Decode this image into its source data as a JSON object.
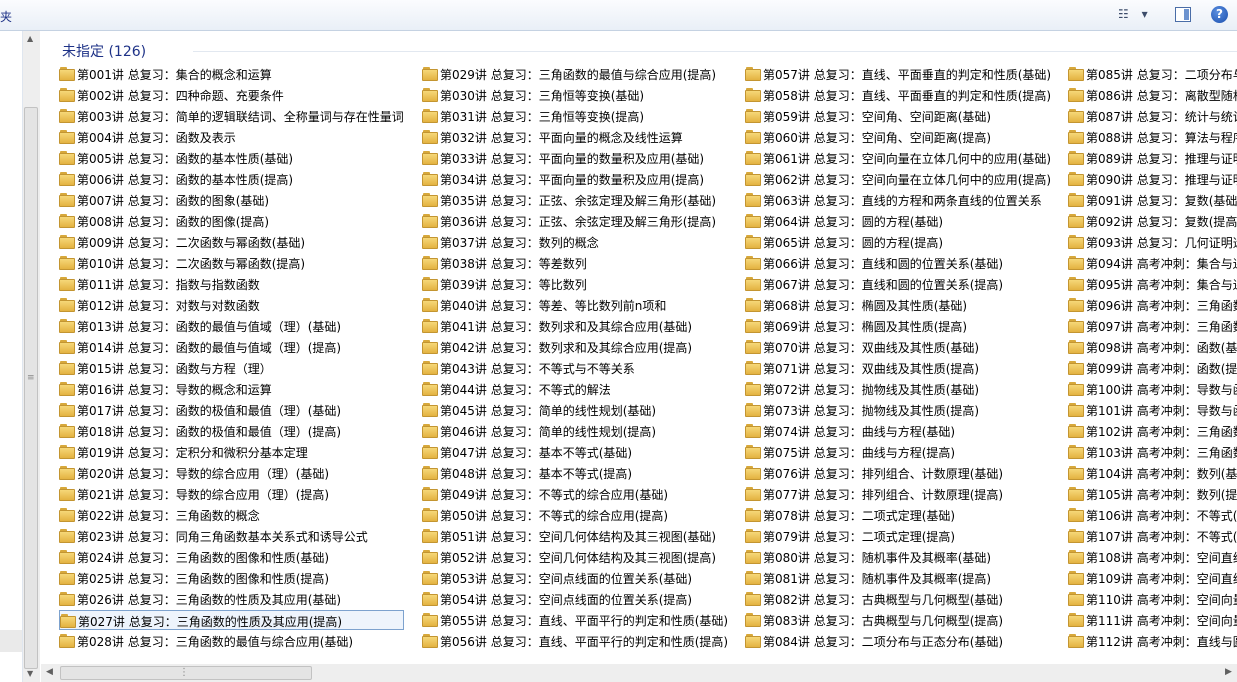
{
  "toolbar": {
    "left_text": "夹",
    "view_glyph": "☷",
    "view_dropdown": "▾",
    "help_glyph": "?"
  },
  "group": {
    "header": "未指定 (126)"
  },
  "icons": {
    "folder": "folder-icon",
    "help": "help-icon",
    "views": "change-view-icon",
    "preview": "preview-pane-icon"
  },
  "colors": {
    "header_blue": "#1e3287",
    "folder_yellow": "#e3b241",
    "selection_border": "#7da2ce"
  },
  "selected_index": 26,
  "items": [
    "第001讲 总复习：集合的概念和运算",
    "第002讲 总复习：四种命题、充要条件",
    "第003讲 总复习：简单的逻辑联结词、全称量词与存在性量词",
    "第004讲 总复习：函数及表示",
    "第005讲 总复习：函数的基本性质(基础)",
    "第006讲 总复习：函数的基本性质(提高)",
    "第007讲 总复习：函数的图象(基础)",
    "第008讲 总复习：函数的图像(提高)",
    "第009讲 总复习：二次函数与幂函数(基础)",
    "第010讲 总复习：二次函数与幂函数(提高)",
    "第011讲 总复习：指数与指数函数",
    "第012讲 总复习：对数与对数函数",
    "第013讲 总复习：函数的最值与值域（理）(基础)",
    "第014讲 总复习：函数的最值与值域（理）(提高)",
    "第015讲 总复习：函数与方程（理）",
    "第016讲 总复习：导数的概念和运算",
    "第017讲 总复习：函数的极值和最值（理）(基础)",
    "第018讲 总复习：函数的极值和最值（理）(提高)",
    "第019讲 总复习：定积分和微积分基本定理",
    "第020讲 总复习：导数的综合应用（理）(基础)",
    "第021讲 总复习：导数的综合应用（理）(提高)",
    "第022讲 总复习：三角函数的概念",
    "第023讲 总复习：同角三角函数基本关系式和诱导公式",
    "第024讲 总复习：三角函数的图像和性质(基础)",
    "第025讲 总复习：三角函数的图像和性质(提高)",
    "第026讲 总复习：三角函数的性质及其应用(基础)",
    "第027讲 总复习：三角函数的性质及其应用(提高)",
    "第028讲 总复习：三角函数的最值与综合应用(基础)",
    "第029讲 总复习：三角函数的最值与综合应用(提高)",
    "第030讲 总复习：三角恒等变换(基础)",
    "第031讲 总复习：三角恒等变换(提高)",
    "第032讲 总复习：平面向量的概念及线性运算",
    "第033讲 总复习：平面向量的数量积及应用(基础)",
    "第034讲 总复习：平面向量的数量积及应用(提高)",
    "第035讲 总复习：正弦、余弦定理及解三角形(基础)",
    "第036讲 总复习：正弦、余弦定理及解三角形(提高)",
    "第037讲 总复习：数列的概念",
    "第038讲 总复习：等差数列",
    "第039讲 总复习：等比数列",
    "第040讲 总复习：等差、等比数列前n项和",
    "第041讲 总复习：数列求和及其综合应用(基础)",
    "第042讲 总复习：数列求和及其综合应用(提高)",
    "第043讲 总复习：不等式与不等关系",
    "第044讲 总复习：不等式的解法",
    "第045讲 总复习：简单的线性规划(基础)",
    "第046讲 总复习：简单的线性规划(提高)",
    "第047讲 总复习：基本不等式(基础)",
    "第048讲 总复习：基本不等式(提高)",
    "第049讲 总复习：不等式的综合应用(基础)",
    "第050讲 总复习：不等式的综合应用(提高)",
    "第051讲 总复习：空间几何体结构及其三视图(基础)",
    "第052讲 总复习：空间几何体结构及其三视图(提高)",
    "第053讲 总复习：空间点线面的位置关系(基础)",
    "第054讲 总复习：空间点线面的位置关系(提高)",
    "第055讲 总复习：直线、平面平行的判定和性质(基础)",
    "第056讲 总复习：直线、平面平行的判定和性质(提高)",
    "第057讲 总复习：直线、平面垂直的判定和性质(基础)",
    "第058讲 总复习：直线、平面垂直的判定和性质(提高)",
    "第059讲 总复习：空间角、空间距离(基础)",
    "第060讲 总复习：空间角、空间距离(提高)",
    "第061讲 总复习：空间向量在立体几何中的应用(基础)",
    "第062讲 总复习：空间向量在立体几何中的应用(提高)",
    "第063讲 总复习：直线的方程和两条直线的位置关系",
    "第064讲 总复习：圆的方程(基础)",
    "第065讲 总复习：圆的方程(提高)",
    "第066讲 总复习：直线和圆的位置关系(基础)",
    "第067讲 总复习：直线和圆的位置关系(提高)",
    "第068讲 总复习：椭圆及其性质(基础)",
    "第069讲 总复习：椭圆及其性质(提高)",
    "第070讲 总复习：双曲线及其性质(基础)",
    "第071讲 总复习：双曲线及其性质(提高)",
    "第072讲 总复习：抛物线及其性质(基础)",
    "第073讲 总复习：抛物线及其性质(提高)",
    "第074讲 总复习：曲线与方程(基础)",
    "第075讲 总复习：曲线与方程(提高)",
    "第076讲 总复习：排列组合、计数原理(基础)",
    "第077讲 总复习：排列组合、计数原理(提高)",
    "第078讲 总复习：二项式定理(基础)",
    "第079讲 总复习：二项式定理(提高)",
    "第080讲 总复习：随机事件及其概率(基础)",
    "第081讲 总复习：随机事件及其概率(提高)",
    "第082讲 总复习：古典概型与几何概型(基础)",
    "第083讲 总复习：古典概型与几何概型(提高)",
    "第084讲 总复习：二项分布与正态分布(基础)",
    "第085讲 总复习：二项分布与",
    "第086讲 总复习：离散型随机",
    "第087讲 总复习：统计与统计",
    "第088讲 总复习：算法与程序",
    "第089讲 总复习：推理与证明",
    "第090讲 总复习：推理与证明",
    "第091讲 总复习：复数(基础",
    "第092讲 总复习：复数(提高",
    "第093讲 总复习：几何证明选",
    "第094讲 高考冲刺：集合与逻",
    "第095讲 高考冲刺：集合与逻",
    "第096讲 高考冲刺：三角函数",
    "第097讲 高考冲刺：三角函数",
    "第098讲 高考冲刺：函数(基",
    "第099讲 高考冲刺：函数(提",
    "第100讲 高考冲刺：导数与函",
    "第101讲 高考冲刺：导数与函",
    "第102讲 高考冲刺：三角函数",
    "第103讲 高考冲刺：三角函数",
    "第104讲 高考冲刺：数列(基",
    "第105讲 高考冲刺：数列(提",
    "第106讲 高考冲刺：不等式(",
    "第107讲 高考冲刺：不等式(",
    "第108讲 高考冲刺：空间直线",
    "第109讲 高考冲刺：空间直线",
    "第110讲 高考冲刺：空间向量",
    "第111讲 高考冲刺：空间向量",
    "第112讲 高考冲刺：直线与圆"
  ]
}
